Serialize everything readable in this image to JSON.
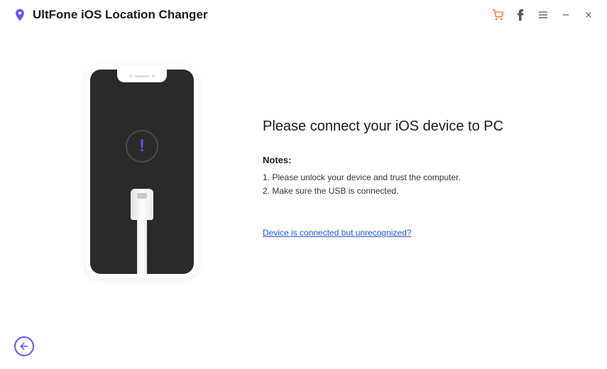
{
  "app": {
    "title": "UltFone iOS Location Changer"
  },
  "main": {
    "heading": "Please connect your iOS device to PC",
    "notes_label": "Notes:",
    "notes": {
      "item1": "1. Please unlock your device and trust the computer.",
      "item2": "2. Make sure the USB is connected."
    },
    "help_link": "Device is connected but unrecognized?"
  },
  "alert_symbol": "!"
}
